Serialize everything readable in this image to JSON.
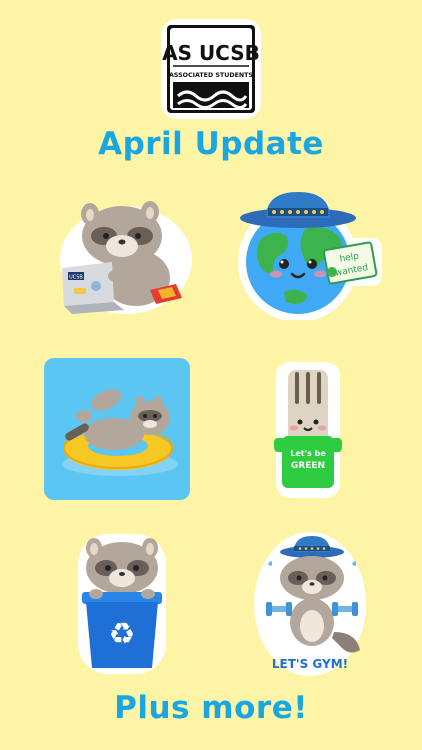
{
  "colors": {
    "background": "#fdf4a6",
    "title": "#1aa6e0",
    "raccoon_fur": "#b0a49a",
    "pool": "#5cc6f2",
    "recycle_bin": "#1e6fd6",
    "shirt_green": "#2ecc40"
  },
  "logo": {
    "line1": "AS UCSB",
    "line2": "ASSOCIATED STUDENTS"
  },
  "header_title": "April Update",
  "footer_title": "Plus more!",
  "stickers": {
    "laptop": {
      "sticker_text": "UCSB"
    },
    "earth": {
      "sign_line1": "help",
      "sign_line2": "wanted"
    },
    "pool": {},
    "fork": {
      "shirt_line1": "Let's be",
      "shirt_line2": "GREEN"
    },
    "recycle": {},
    "gym": {
      "caption": "LET'S GYM!"
    }
  }
}
